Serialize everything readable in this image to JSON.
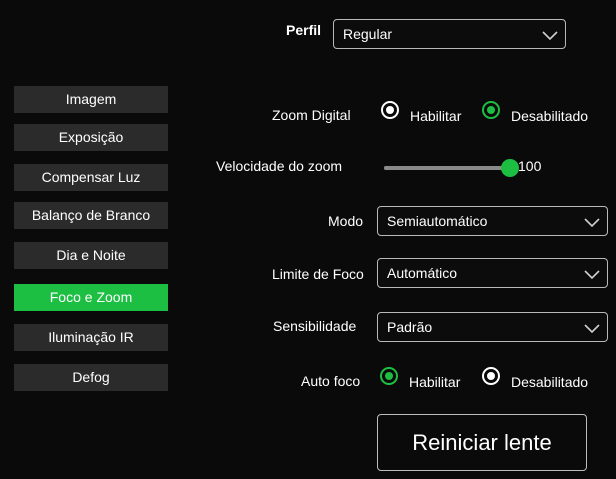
{
  "profile": {
    "label": "Perfil",
    "value": "Regular"
  },
  "sidebar": {
    "items": [
      {
        "label": "Imagem",
        "active": false
      },
      {
        "label": "Exposição",
        "active": false
      },
      {
        "label": "Compensar Luz",
        "active": false
      },
      {
        "label": "Balanço de Branco",
        "active": false
      },
      {
        "label": "Dia e Noite",
        "active": false
      },
      {
        "label": "Foco e Zoom",
        "active": true
      },
      {
        "label": "Iluminação IR",
        "active": false
      },
      {
        "label": "Defog",
        "active": false
      }
    ]
  },
  "zoom_digital": {
    "label": "Zoom Digital",
    "options": [
      "Habilitar",
      "Desabilitado"
    ],
    "selected": "Desabilitado"
  },
  "zoom_speed": {
    "label": "Velocidade do zoom",
    "value": 100,
    "max": 100
  },
  "mode": {
    "label": "Modo",
    "value": "Semiautomático"
  },
  "focus_limit": {
    "label": "Limite de Foco",
    "value": "Automático"
  },
  "sensitivity": {
    "label": "Sensibilidade",
    "value": "Padrão"
  },
  "auto_focus": {
    "label": "Auto foco",
    "options": [
      "Habilitar",
      "Desabilitado"
    ],
    "selected": "Habilitar"
  },
  "reset_button": {
    "label": "Reiniciar lente"
  },
  "colors": {
    "accent": "#1dbf43",
    "background": "#0a0a0a",
    "sidebar_item": "#2b2b2b"
  }
}
